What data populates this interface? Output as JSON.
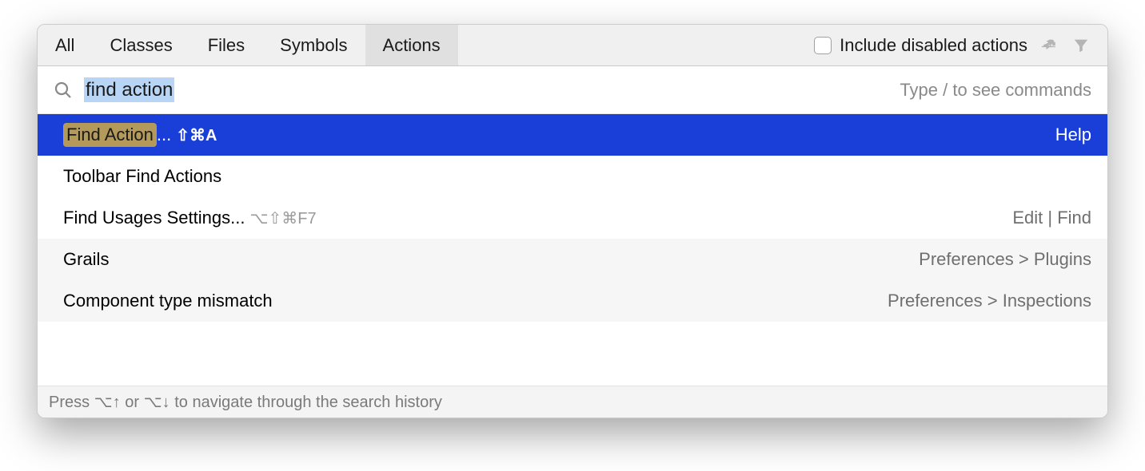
{
  "tabs": {
    "all": "All",
    "classes": "Classes",
    "files": "Files",
    "symbols": "Symbols",
    "actions": "Actions"
  },
  "controls": {
    "include_disabled_label": "Include disabled actions"
  },
  "search": {
    "value": "find action",
    "hint": "Type / to see commands"
  },
  "results": {
    "r0": {
      "highlight": "Find Action",
      "suffix": "...",
      "shortcut": "⇧⌘A",
      "right": "Help"
    },
    "r1": {
      "label": "Toolbar Find Actions",
      "right": ""
    },
    "r2": {
      "label": "Find Usages Settings...",
      "shortcut": "⌥⇧⌘F7",
      "right": "Edit | Find"
    },
    "r3": {
      "label": "Grails",
      "right": "Preferences > Plugins"
    },
    "r4": {
      "label": "Component type mismatch",
      "right": "Preferences > Inspections"
    }
  },
  "footer": {
    "hint": "Press ⌥↑ or ⌥↓ to navigate through the search history"
  }
}
